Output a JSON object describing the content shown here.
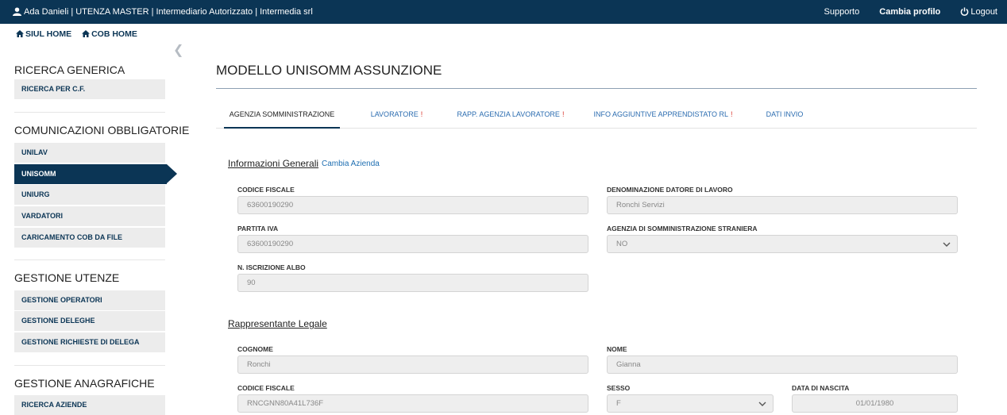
{
  "topbar": {
    "user_info": "Ada Danieli | UTENZA MASTER | Intermediario Autorizzato | Intermedia srl",
    "support": "Supporto",
    "change_profile": "Cambia profilo",
    "logout": "Logout"
  },
  "home_links": {
    "siul_home": "SIUL HOME",
    "cob_home": "COB HOME"
  },
  "sidebar": {
    "ricerca_generica": {
      "title": "RICERCA GENERICA",
      "items": [
        "RICERCA PER C.F."
      ]
    },
    "comunicazioni": {
      "title": "COMUNICAZIONI OBBLIGATORIE",
      "items": [
        "UNILAV",
        "UNISOMM",
        "UNIURG",
        "VARDATORI",
        "CARICAMENTO COB DA FILE"
      ],
      "active": "UNISOMM"
    },
    "gestione_utenze": {
      "title": "GESTIONE UTENZE",
      "items": [
        "GESTIONE OPERATORI",
        "GESTIONE DELEGHE",
        "GESTIONE RICHIESTE DI DELEGA"
      ]
    },
    "gestione_anagrafiche": {
      "title": "GESTIONE ANAGRAFICHE",
      "items": [
        "RICERCA AZIENDE"
      ]
    }
  },
  "main": {
    "title": "MODELLO UNISOMM ASSUNZIONE",
    "tabs": [
      {
        "label": "AGENZIA SOMMINISTRAZIONE",
        "warning": ""
      },
      {
        "label": "LAVORATORE",
        "warning": "!"
      },
      {
        "label": "RAPP. AGENZIA LAVORATORE",
        "warning": "!"
      },
      {
        "label": "INFO AGGIUNTIVE APPRENDISTATO RL",
        "warning": "!"
      },
      {
        "label": "DATI INVIO",
        "warning": ""
      }
    ],
    "info_generali": {
      "title": "Informazioni Generali",
      "change_link": "Cambia Azienda",
      "codice_fiscale": {
        "label": "CODICE FISCALE",
        "value": "63600190290"
      },
      "denominazione": {
        "label": "DENOMINAZIONE DATORE DI LAVORO",
        "value": "Ronchi Servizi"
      },
      "partita_iva": {
        "label": "PARTITA IVA",
        "value": "63600190290"
      },
      "agenzia_straniera": {
        "label": "AGENZIA DI SOMMINISTRAZIONE STRANIERA",
        "value": "NO"
      },
      "iscrizione_albo": {
        "label": "N. ISCRIZIONE ALBO",
        "value": "90"
      }
    },
    "rappresentante": {
      "title": "Rappresentante Legale",
      "cognome": {
        "label": "COGNOME",
        "value": "Ronchi"
      },
      "nome": {
        "label": "NOME",
        "value": "Gianna"
      },
      "codice_fiscale": {
        "label": "CODICE FISCALE",
        "value": "RNCGNN80A41L736F"
      },
      "sesso": {
        "label": "SESSO",
        "value": "F"
      },
      "data_nascita": {
        "label": "DATA DI NASCITA",
        "value": "01/01/1980"
      }
    }
  }
}
